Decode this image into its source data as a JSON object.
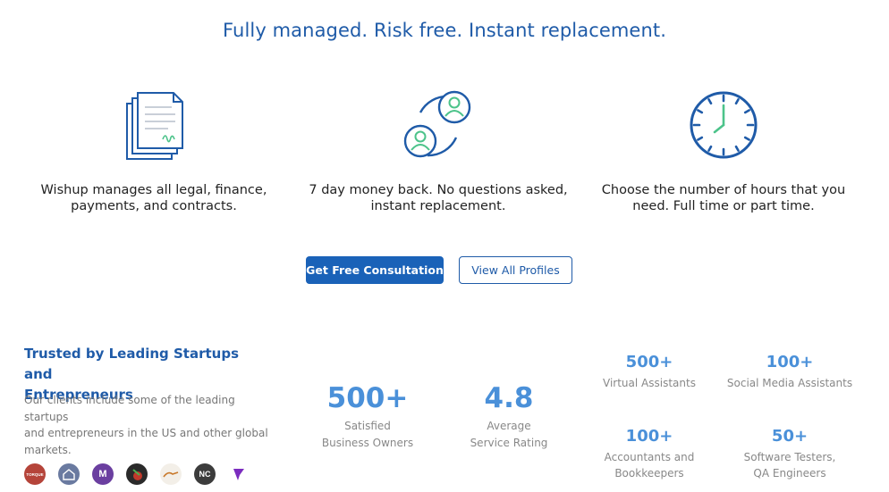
{
  "headline": "Fully managed. Risk free. Instant replacement.",
  "features": [
    {
      "line1": "Wishup manages all legal, finance,",
      "line2": "payments, and contracts.",
      "icon": "contract-document-icon"
    },
    {
      "line1": "7 day money back. No questions asked,",
      "line2": "instant replacement.",
      "icon": "user-swap-icon"
    },
    {
      "line1": "Choose the number of hours that you",
      "line2": "need. Full time or part time.",
      "icon": "clock-icon"
    }
  ],
  "buttons": {
    "consultation": "Get Free Consultation",
    "profiles": "View All Profiles"
  },
  "trust": {
    "title_line1": "Trusted by Leading Startups and",
    "title_line2": "Entrepreneurs",
    "desc_line1": "Our clients include some of the leading startups",
    "desc_line2": "and entrepreneurs in the US and other global",
    "desc_line3": "markets."
  },
  "logos": [
    {
      "name": "torque-logo",
      "text": "TORQUE",
      "color": "#b5443a"
    },
    {
      "name": "house-logo",
      "text": "",
      "color": "#6a7aa0"
    },
    {
      "name": "m-logo",
      "text": "M",
      "color": "#6b3fa0"
    },
    {
      "name": "leaf-logo",
      "text": "",
      "color": "#2a2a2a"
    },
    {
      "name": "runner-logo",
      "text": "",
      "color": "#f3efe8"
    },
    {
      "name": "nc-logo",
      "text": "NC",
      "color": "#3c3c3c"
    },
    {
      "name": "flag-logo",
      "text": "",
      "color": "#ffffff"
    }
  ],
  "stats_big": [
    {
      "num": "500+",
      "lbl1": "Satisfied",
      "lbl2": "Business Owners"
    },
    {
      "num": "4.8",
      "lbl1": "Average",
      "lbl2": "Service Rating"
    }
  ],
  "stats_small": [
    {
      "num": "500+",
      "lbl1": "Virtual Assistants",
      "lbl2": ""
    },
    {
      "num": "100+",
      "lbl1": "Social Media Assistants",
      "lbl2": ""
    },
    {
      "num": "100+",
      "lbl1": "Accountants and",
      "lbl2": "Bookkeepers"
    },
    {
      "num": "50+",
      "lbl1": "Software Testers,",
      "lbl2": "QA Engineers"
    }
  ],
  "colors": {
    "brand_blue": "#1f5ba8",
    "stat_blue": "#4a90d9",
    "accent_green": "#4cc38a"
  }
}
